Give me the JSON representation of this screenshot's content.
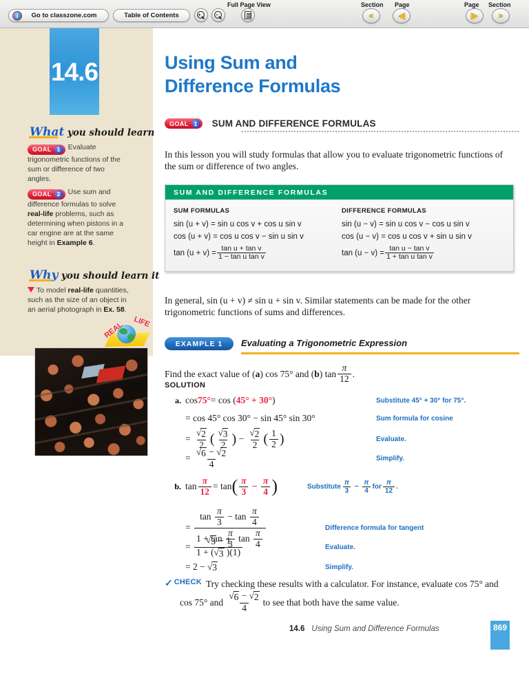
{
  "toolbar": {
    "classzone_label": "Go to classzone.com",
    "toc_label": "Table of Contents",
    "zoom_in_label": "+",
    "zoom_out_label": "−",
    "fullpage_label": "Full Page View",
    "section_prev_label": "Section",
    "page_prev_label": "Page",
    "page_next_label": "Page",
    "section_next_label": "Section",
    "section_prev_glyph": "«",
    "page_prev_glyph": "◀",
    "page_next_glyph": "▶",
    "section_next_glyph": "»",
    "info_glyph": "i"
  },
  "sidebar": {
    "chapter_number": "14.6",
    "what_heading_word1": "What",
    "what_heading_word2": "you should learn",
    "why_heading_word1": "Why",
    "why_heading_word2": "you should learn it",
    "goal1": {
      "badge_label": "GOAL",
      "badge_number": "1",
      "text": "Evaluate trigonometric functions of the sum or difference of two angles."
    },
    "goal2": {
      "badge_label": "GOAL",
      "badge_number": "2",
      "text_a": "Use sum and difference formulas to solve ",
      "bold_b": "real-life",
      "text_c": " problems, such as determining when pistons in a car engine are at the same height in ",
      "bold_d": "Example 6",
      "text_e": "."
    },
    "why": {
      "text_a": "To model ",
      "bold_b": "real-life",
      "text_c": " quantities, such as the size of an object in an aerial photograph in ",
      "bold_d": "Ex. 58",
      "text_e": "."
    },
    "seal": {
      "word1": "REAL",
      "word2": "LIFE"
    },
    "photo_caption": "aerial photograph of an orchard with a red-roofed building"
  },
  "main": {
    "title_line1": "Using Sum and",
    "title_line2": "Difference Formulas",
    "goal_badge_label": "GOAL",
    "goal_badge_number": "1",
    "goal_heading": "Sum and Difference Formulas",
    "intro_paragraph": "In this lesson you will study formulas that allow you to evaluate trigonometric functions of the sum or difference of two angles.",
    "general_paragraph": "In general, sin (u + v) ≠ sin u + sin v. Similar statements can be made for the other trigonometric functions of sums and differences."
  },
  "formula_box": {
    "header": "SUM AND DIFFERENCE FORMULAS",
    "sum_heading": "SUM FORMULAS",
    "difference_heading": "DIFFERENCE FORMULAS",
    "sum_lines": [
      "sin (u + v) = sin u cos v + cos u sin v",
      "cos (u + v) = cos u cos v − sin u sin v"
    ],
    "sum_tan_lhs": "tan (u + v) =",
    "sum_tan_num": "tan u + tan v",
    "sum_tan_den": "1 − tan u tan v",
    "difference_lines": [
      "sin (u − v) = sin u cos v − cos u sin v",
      "cos (u − v) = cos u cos v + sin u sin v"
    ],
    "diff_tan_lhs": "tan (u − v) =",
    "diff_tan_num": "tan u − tan v",
    "diff_tan_den": "1 + tan u tan v"
  },
  "example": {
    "badge": "EXAMPLE 1",
    "title": "Evaluating a Trigonometric Expression",
    "prompt_a": "Find the exact value of (",
    "prompt_bold_a": "a",
    "prompt_b": ") cos 75° and (",
    "prompt_bold_b": "b",
    "prompt_c": ") tan ",
    "prompt_frac_num": "π",
    "prompt_frac_den": "12",
    "prompt_end": ".",
    "solution_heading": "Solution",
    "part_a": {
      "label": "a.",
      "steps": [
        {
          "note": "Substitute 45° + 30° for 75°."
        },
        {
          "math": "= cos 45° cos 30° − sin 45° sin 30°",
          "note": "Sum formula for cosine"
        },
        {
          "note": "Evaluate."
        },
        {
          "note": "Simplify."
        }
      ],
      "line1_lhs": "cos ",
      "line1_red1": "75°",
      "line1_mid": " = cos (",
      "line1_red2": "45° + 30°",
      "line1_end": ")"
    },
    "part_b": {
      "label": "b.",
      "lhs": "tan ",
      "lhs_num": "π",
      "lhs_den": "12",
      "mid": " = tan",
      "arg_num1": "π",
      "arg_den1": "3",
      "arg_minus": "−",
      "arg_num2": "π",
      "arg_den2": "4",
      "notes": [
        "Substitute",
        "Difference formula for tangent",
        "Evaluate.",
        "Simplify."
      ],
      "sub_note_pre": "Substitute ",
      "sub_note_for": " for ",
      "sub_note_end": ".",
      "step2_num": "tan π/3 − tan π/4",
      "step2_den": "1 + tan π/3 tan π/4",
      "step3_num": "√3 − 1",
      "step3_den": "1 + (√3 )(1)",
      "step4": "= 2 − √3"
    }
  },
  "check": {
    "tag": "CHECK",
    "text_a": "Try checking these results with a calculator. For instance, evaluate cos 75° and ",
    "text_b": " to see that both have the same value.",
    "frac_num": "√6 − √2",
    "frac_den": "4"
  },
  "footer": {
    "section_number": "14.6",
    "section_title": "Using Sum and Difference Formulas",
    "page_number": "869"
  },
  "colors": {
    "accent_blue": "#1e78c8",
    "sidebar_beige": "#ece4cf",
    "chapter_blue": "#4aa8e0",
    "formula_green": "#00a06b",
    "goal_red": "#e8253d",
    "note_blue": "#1e6fc0",
    "rule_gold": "#f2b01e"
  }
}
